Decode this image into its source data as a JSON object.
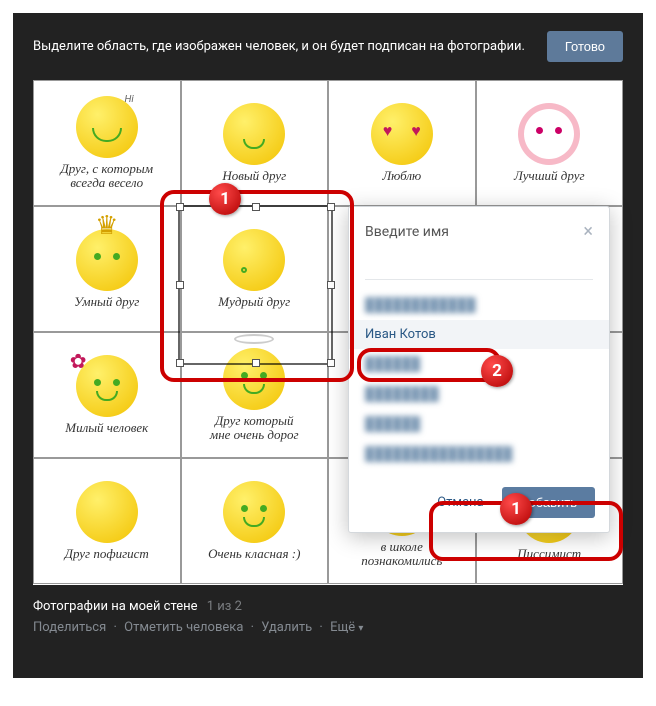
{
  "topbar": {
    "instruction": "Выделите область, где изображен человек, и он будет подписан на фотографии.",
    "done": "Готово"
  },
  "tiles": [
    {
      "caption": "Друг, с которым\nвсегда весело"
    },
    {
      "caption": "Новый друг"
    },
    {
      "caption": "Люблю"
    },
    {
      "caption": "Лучший друг"
    },
    {
      "caption": "Умный друг"
    },
    {
      "caption": "Мудрый друг"
    },
    {
      "caption": ""
    },
    {
      "caption": ""
    },
    {
      "caption": "Милый человек"
    },
    {
      "caption": "Друг который\nмне очень дорог"
    },
    {
      "caption": ""
    },
    {
      "caption": ""
    },
    {
      "caption": "Друг пофигист"
    },
    {
      "caption": "Очень класная :)"
    },
    {
      "caption": "в школе\nпознакомились"
    },
    {
      "caption": "Писсимист"
    }
  ],
  "popup": {
    "title": "Введите имя",
    "selected_name": "Иван Котов",
    "cancel": "Отмена",
    "add": "Добавить"
  },
  "callouts": {
    "one": "1",
    "two": "2"
  },
  "meta": {
    "album": "Фотографии на моей стене",
    "counter": "1 из 2",
    "share": "Поделиться",
    "tag": "Отметить человека",
    "delete": "Удалить",
    "more": "Ещё"
  }
}
